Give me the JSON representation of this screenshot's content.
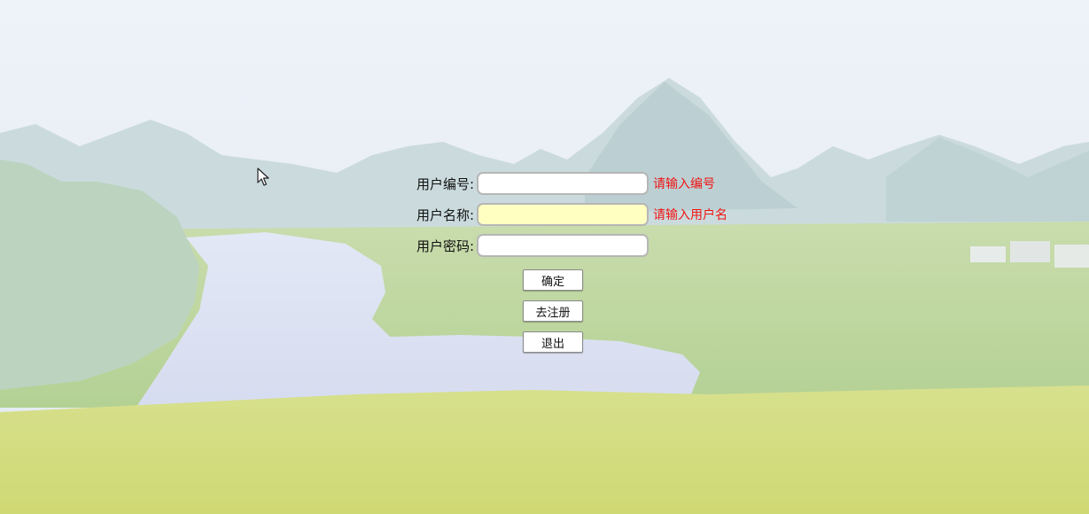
{
  "form": {
    "user_id_label": "用户编号:",
    "user_id_value": "",
    "user_id_error": "请输入编号",
    "username_label": "用户名称:",
    "username_value": "",
    "username_error": "请输入用户名",
    "password_label": "用户密码:",
    "password_value": ""
  },
  "buttons": {
    "confirm": "确定",
    "register": "去注册",
    "exit": "退出"
  },
  "colors": {
    "error_text": "#f01414",
    "highlight_field": "#ffffc2"
  }
}
